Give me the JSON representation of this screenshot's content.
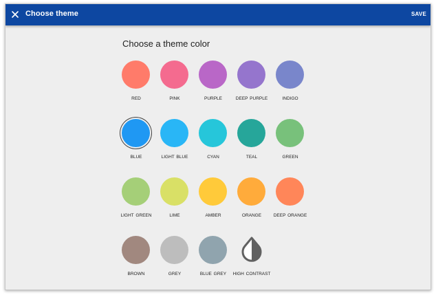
{
  "appbar": {
    "title": "Choose theme",
    "close_icon": "close-icon",
    "save_label": "SAVE",
    "color": "#0d47a1"
  },
  "section_title": "Choose a theme color",
  "selected_theme": "BLUE",
  "swatches": [
    {
      "label": "RED",
      "color": "#ff7b6a"
    },
    {
      "label": "PINK",
      "color": "#f46b8f"
    },
    {
      "label": "PURPLE",
      "color": "#b967c7"
    },
    {
      "label": "DEEP PURPLE",
      "color": "#9575cd"
    },
    {
      "label": "INDIGO",
      "color": "#7986cb"
    },
    {
      "label": "BLUE",
      "color": "#1f98f3"
    },
    {
      "label": "LIGHT BLUE",
      "color": "#29b6f6"
    },
    {
      "label": "CYAN",
      "color": "#26c6da"
    },
    {
      "label": "TEAL",
      "color": "#26a69a"
    },
    {
      "label": "GREEN",
      "color": "#78c17b"
    },
    {
      "label": "LIGHT GREEN",
      "color": "#a5cf78"
    },
    {
      "label": "LIME",
      "color": "#d9e066"
    },
    {
      "label": "AMBER",
      "color": "#ffca3a"
    },
    {
      "label": "ORANGE",
      "color": "#ffab3b"
    },
    {
      "label": "DEEP ORANGE",
      "color": "#ff8659"
    },
    {
      "label": "BROWN",
      "color": "#a1887f"
    },
    {
      "label": "GREY",
      "color": "#bdbdbd"
    },
    {
      "label": "BLUE GREY",
      "color": "#90a4ae"
    },
    {
      "label": "HIGH CONTRAST",
      "color": "#616161",
      "icon": "contrast-drop-icon"
    }
  ]
}
